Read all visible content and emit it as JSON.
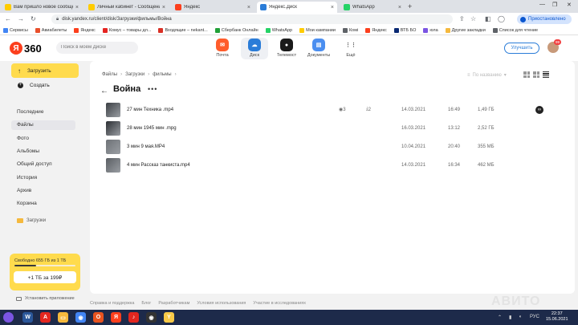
{
  "tabs": [
    {
      "label": "Вам пришло новое сообщение",
      "color": "#ffcc00"
    },
    {
      "label": "Личный кабинет - Сообщения",
      "color": "#ffcc00"
    },
    {
      "label": "Яндекс",
      "color": "#fc3f1d"
    },
    {
      "label": "Яндекс.Диск",
      "color": "#2a7cd8",
      "active": true
    },
    {
      "label": "WhatsApp",
      "color": "#25d366"
    }
  ],
  "address": {
    "url": "disk.yandex.ru/client/disk/Загрузки/фильмы/Война",
    "paused_label": "Приостановлено"
  },
  "bookmarks": [
    {
      "label": "Сервисы",
      "color": "#4285f4"
    },
    {
      "label": "Авиабилеты",
      "color": "#e84f2b"
    },
    {
      "label": "Яндекс",
      "color": "#fc3f1d"
    },
    {
      "label": "Комус – товары дл...",
      "color": "#e52421"
    },
    {
      "label": "Входящие – nekant...",
      "color": "#d93025"
    },
    {
      "label": "Сбербанк Онлайн",
      "color": "#21a038"
    },
    {
      "label": "WhatsApp",
      "color": "#25d366"
    },
    {
      "label": "Мои кампании",
      "color": "#ffcc00"
    },
    {
      "label": "Комі",
      "color": "#5f6368"
    },
    {
      "label": "Яндекс",
      "color": "#fc3f1d"
    },
    {
      "label": "ВТБ БО",
      "color": "#0a2973"
    },
    {
      "label": "юла",
      "color": "#7b55e2"
    },
    {
      "label": "Другие закладки",
      "color": "#f5b93d"
    },
    {
      "label": "Список для чтение",
      "color": "#5f6368"
    }
  ],
  "header": {
    "logo_letter": "Я",
    "logo_number": "360",
    "search_placeholder": "Поиск в моём Диске",
    "services": [
      {
        "label": "Почта",
        "color": "#ff5c2b",
        "glyph": "✉"
      },
      {
        "label": "Диск",
        "color": "#2a7cd8",
        "glyph": "☁",
        "active": true
      },
      {
        "label": "Телемост",
        "color": "#1a1a1a",
        "glyph": "●"
      },
      {
        "label": "Документы",
        "color": "#4a8ef0",
        "glyph": "▤"
      },
      {
        "label": "Ещё",
        "color": "#ffffff",
        "glyph": "⋮⋮"
      }
    ],
    "upgrade_label": "Улучшить",
    "badge_count": "99"
  },
  "sidebar": {
    "upload_label": "Загрузить",
    "create_label": "Создать",
    "items": [
      {
        "label": "Последние"
      },
      {
        "label": "Файлы",
        "active": true
      },
      {
        "label": "Фото"
      },
      {
        "label": "Альбомы"
      },
      {
        "label": "Общий доступ"
      },
      {
        "label": "История"
      },
      {
        "label": "Архив"
      },
      {
        "label": "Корзина"
      }
    ],
    "folder_label": "Загрузки",
    "storage_text": "Свободно 655 ГБ из 1 ТБ",
    "storage_used_fraction": 0.36,
    "storage_button": "+1 ТБ за 199₽",
    "install_label": "Установить приложение"
  },
  "main": {
    "breadcrumbs": [
      "Файлы",
      "Загрузки",
      "фильмы"
    ],
    "sort_label": "По названию",
    "folder_title": "Война",
    "files": [
      {
        "name": "27 мин Техника .mp4",
        "views": "3",
        "downloads": "2",
        "date": "14.03.2021",
        "time": "16:49",
        "size": "1,49 ГБ",
        "thumb": "#3b3f44",
        "shared": true
      },
      {
        "name": "28 мин 1945 мин .mpg",
        "views": "",
        "downloads": "",
        "date": "16.03.2021",
        "time": "13:12",
        "size": "2,52 ГБ",
        "thumb": "#2b2e33",
        "shared": false
      },
      {
        "name": "3 мин 9 мая.МР4",
        "views": "",
        "downloads": "",
        "date": "10.04.2021",
        "time": "20:40",
        "size": "355 МБ",
        "thumb": "#6e7277",
        "shared": false
      },
      {
        "name": "4 мин Рассказ танкиста.mp4",
        "views": "",
        "downloads": "",
        "date": "14.03.2021",
        "time": "16:34",
        "size": "462 МБ",
        "thumb": "#5a5e63",
        "shared": false
      }
    ]
  },
  "footer": {
    "links": [
      "Справка и поддержка",
      "Блог",
      "Разработчикам",
      "Условия использования",
      "Участие в исследованиях"
    ],
    "watermark": "АВИТО"
  },
  "taskbar": {
    "apps": [
      {
        "name": "word-app-icon",
        "color": "#2b579a",
        "glyph": "W"
      },
      {
        "name": "pdf-app-icon",
        "color": "#e3261f",
        "glyph": "A"
      },
      {
        "name": "explorer-app-icon",
        "color": "#f5b93d",
        "glyph": "▭"
      },
      {
        "name": "chrome-app-icon",
        "color": "#4285f4",
        "glyph": "◉"
      },
      {
        "name": "opera-app-icon",
        "color": "#e8531f",
        "glyph": "O"
      },
      {
        "name": "yandex-app-icon",
        "color": "#fc3f1d",
        "glyph": "Я"
      },
      {
        "name": "yandex-music-app-icon",
        "color": "#e3261f",
        "glyph": "♪"
      },
      {
        "name": "media-app-icon",
        "color": "#333333",
        "glyph": "◉"
      },
      {
        "name": "browser-app-icon",
        "color": "#f7c948",
        "glyph": "Y"
      }
    ],
    "lang": "РУС",
    "time": "22:37",
    "date": "15.06.2021"
  }
}
